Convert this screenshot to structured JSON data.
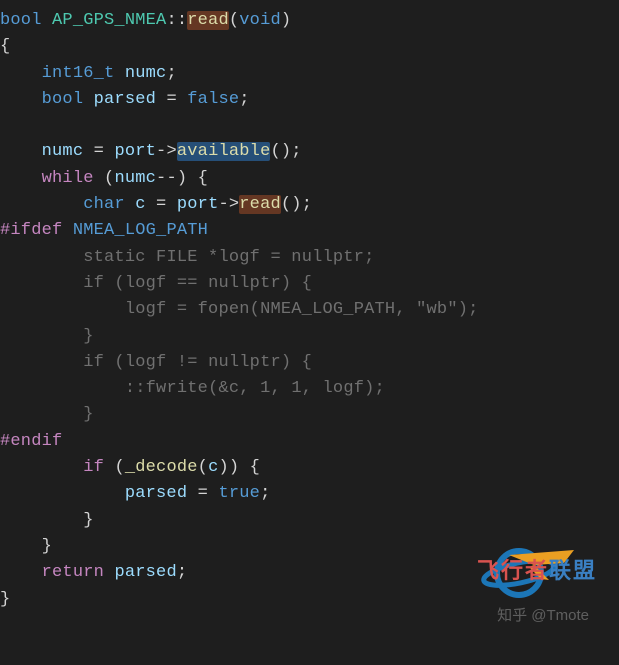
{
  "code": {
    "return_type": "bool",
    "class_name": "AP_GPS_NMEA",
    "method_name": "read",
    "void_arg": "void",
    "decl_int_type": "int16_t",
    "var_numc": "numc",
    "decl_bool_type": "bool",
    "var_parsed": "parsed",
    "false_lit": "false",
    "port_field": "port",
    "available_call": "available",
    "while_kw": "while",
    "char_type": "char",
    "var_c": "c",
    "read_call": "read",
    "ifdef_kw": "#ifdef",
    "ifdef_sym": "NMEA_LOG_PATH",
    "static_kw": "static",
    "file_type": "FILE",
    "var_logf": "logf",
    "nullptr_lit": "nullptr",
    "if_kw": "if",
    "fopen_call": "fopen",
    "fopen_path": "NMEA_LOG_PATH",
    "fopen_mode": "\"wb\"",
    "fwrite_call": "fwrite",
    "one_lit_a": "1",
    "one_lit_b": "1",
    "endif_kw": "#endif",
    "decode_call": "_decode",
    "true_lit": "true",
    "return_kw": "return"
  },
  "watermark": {
    "brand_red": "飞行者",
    "brand_blue": "联盟",
    "zhihu": "知乎 @Tmote"
  }
}
